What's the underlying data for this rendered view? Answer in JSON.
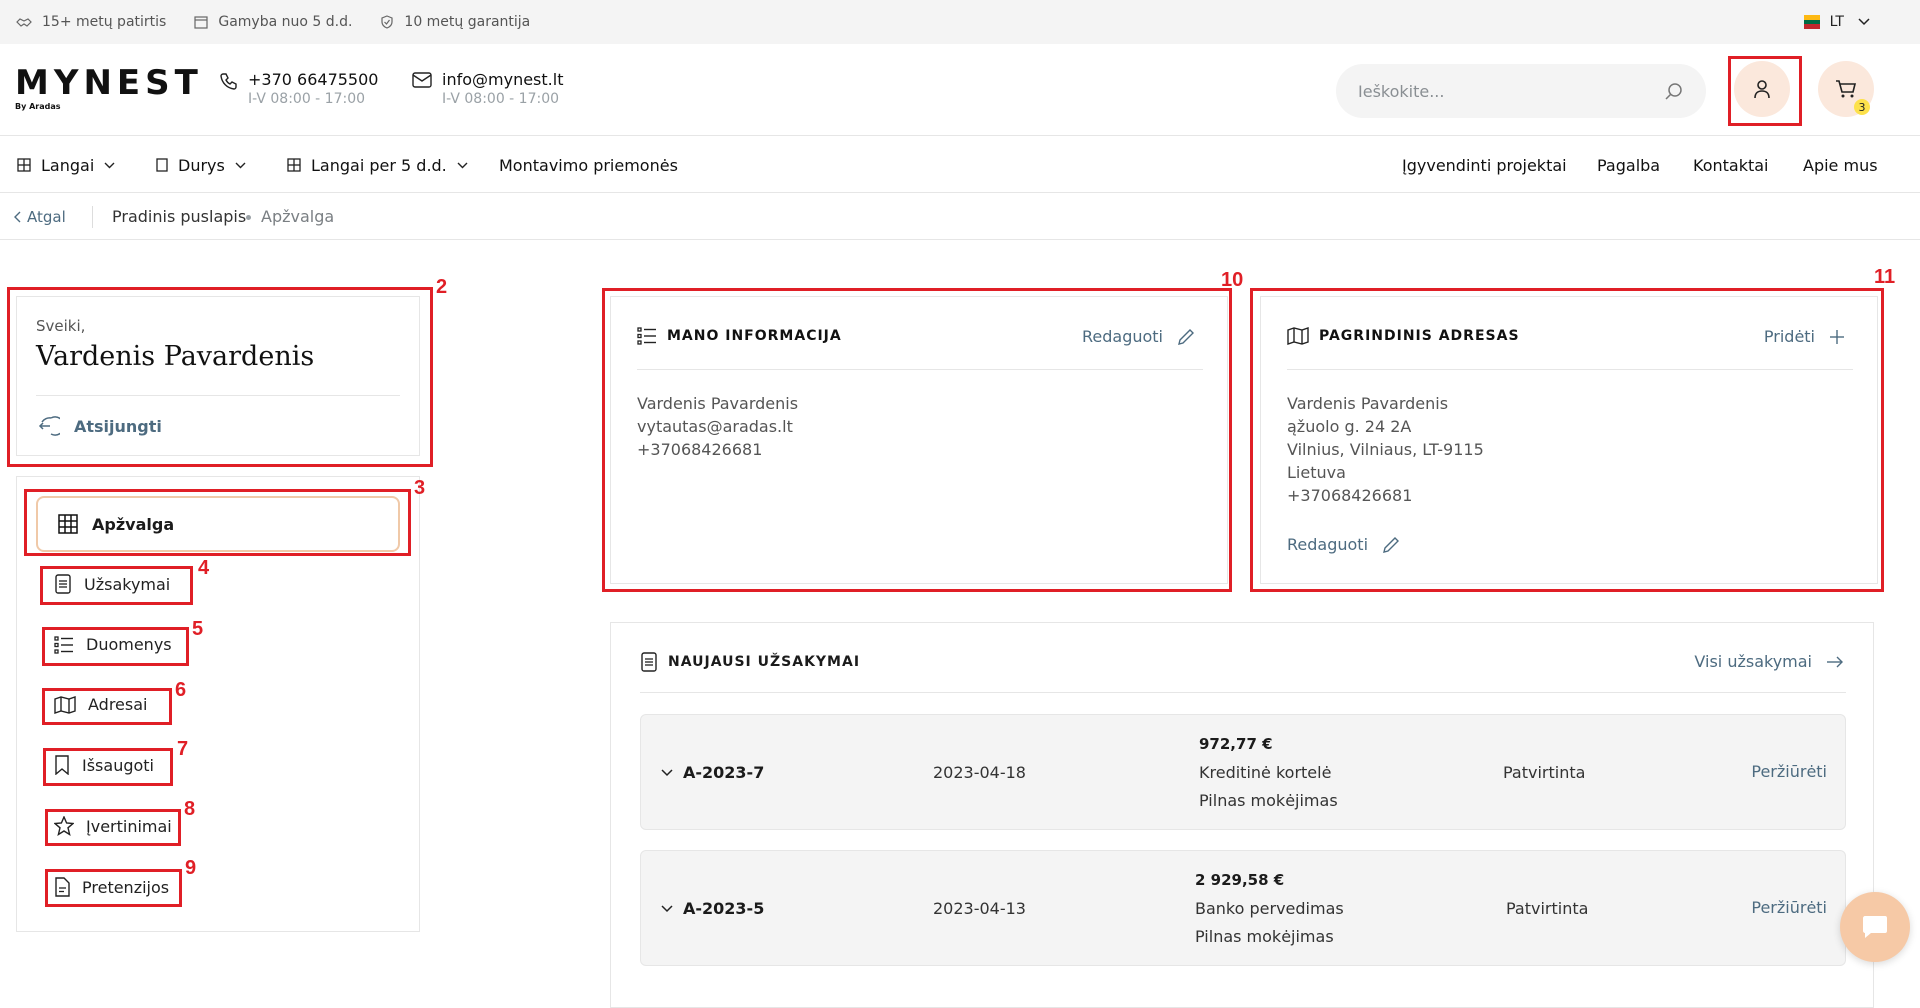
{
  "topbar": {
    "features": [
      "15+ metų patirtis",
      "Gamyba nuo 5 d.d.",
      "10 metų garantija"
    ],
    "language": "LT"
  },
  "header": {
    "logo_main": "MYNEST",
    "logo_sub": "By Aradas",
    "phone": "+370 66475500",
    "phone_hours": "I-V 08:00 - 17:00",
    "email": "info@mynest.lt",
    "email_hours": "I-V 08:00 - 17:00",
    "search_placeholder": "Ieškokite...",
    "cart_count": "3"
  },
  "nav": {
    "left": [
      "Langai",
      "Durys",
      "Langai per 5 d.d.",
      "Montavimo priemonės"
    ],
    "right": [
      "Įgyvendinti projektai",
      "Pagalba",
      "Kontaktai",
      "Apie mus"
    ]
  },
  "breadcrumb": {
    "back": "Atgal",
    "home": "Pradinis puslapis",
    "current": "Apžvalga"
  },
  "account": {
    "greeting": "Sveiki,",
    "name": "Vardenis Pavardenis",
    "logout": "Atsijungti"
  },
  "menu": {
    "active": "Apžvalga",
    "items": [
      "Užsakymai",
      "Duomenys",
      "Adresai",
      "Išsaugoti",
      "Įvertinimai",
      "Pretenzijos"
    ]
  },
  "my_info": {
    "title": "MANO INFORMACIJA",
    "action": "Redaguoti",
    "lines": [
      "Vardenis Pavardenis",
      "vytautas@aradas.lt",
      "+37068426681"
    ]
  },
  "main_address": {
    "title": "PAGRINDINIS ADRESAS",
    "action": "Pridėti",
    "lines": [
      "Vardenis Pavardenis",
      "ąžuolo g. 24 2A",
      "Vilnius, Vilniaus, LT-9115",
      "Lietuva",
      "+37068426681"
    ],
    "edit": "Redaguoti"
  },
  "orders": {
    "title": "NAUJAUSI UŽSAKYMAI",
    "all_link": "Visi užsakymai",
    "rows": [
      {
        "id": "A-2023-7",
        "date": "2023-04-18",
        "amount": "972,77 €",
        "payment": "Kreditinė kortelė",
        "payment_type": "Pilnas mokėjimas",
        "status": "Patvirtinta",
        "view": "Peržiūrėti"
      },
      {
        "id": "A-2023-5",
        "date": "2023-04-13",
        "amount": "2 929,58 €",
        "payment": "Banko pervedimas",
        "payment_type": "Pilnas mokėjimas",
        "status": "Patvirtinta",
        "view": "Peržiūrėti"
      }
    ]
  },
  "annotations": [
    "2",
    "3",
    "4",
    "5",
    "6",
    "7",
    "8",
    "9",
    "10",
    "11"
  ],
  "colors": {
    "annotation": "#e01f26",
    "accent_link": "#4d6b80",
    "accent_soft": "#fbe8dc",
    "badge": "#fde14b"
  }
}
